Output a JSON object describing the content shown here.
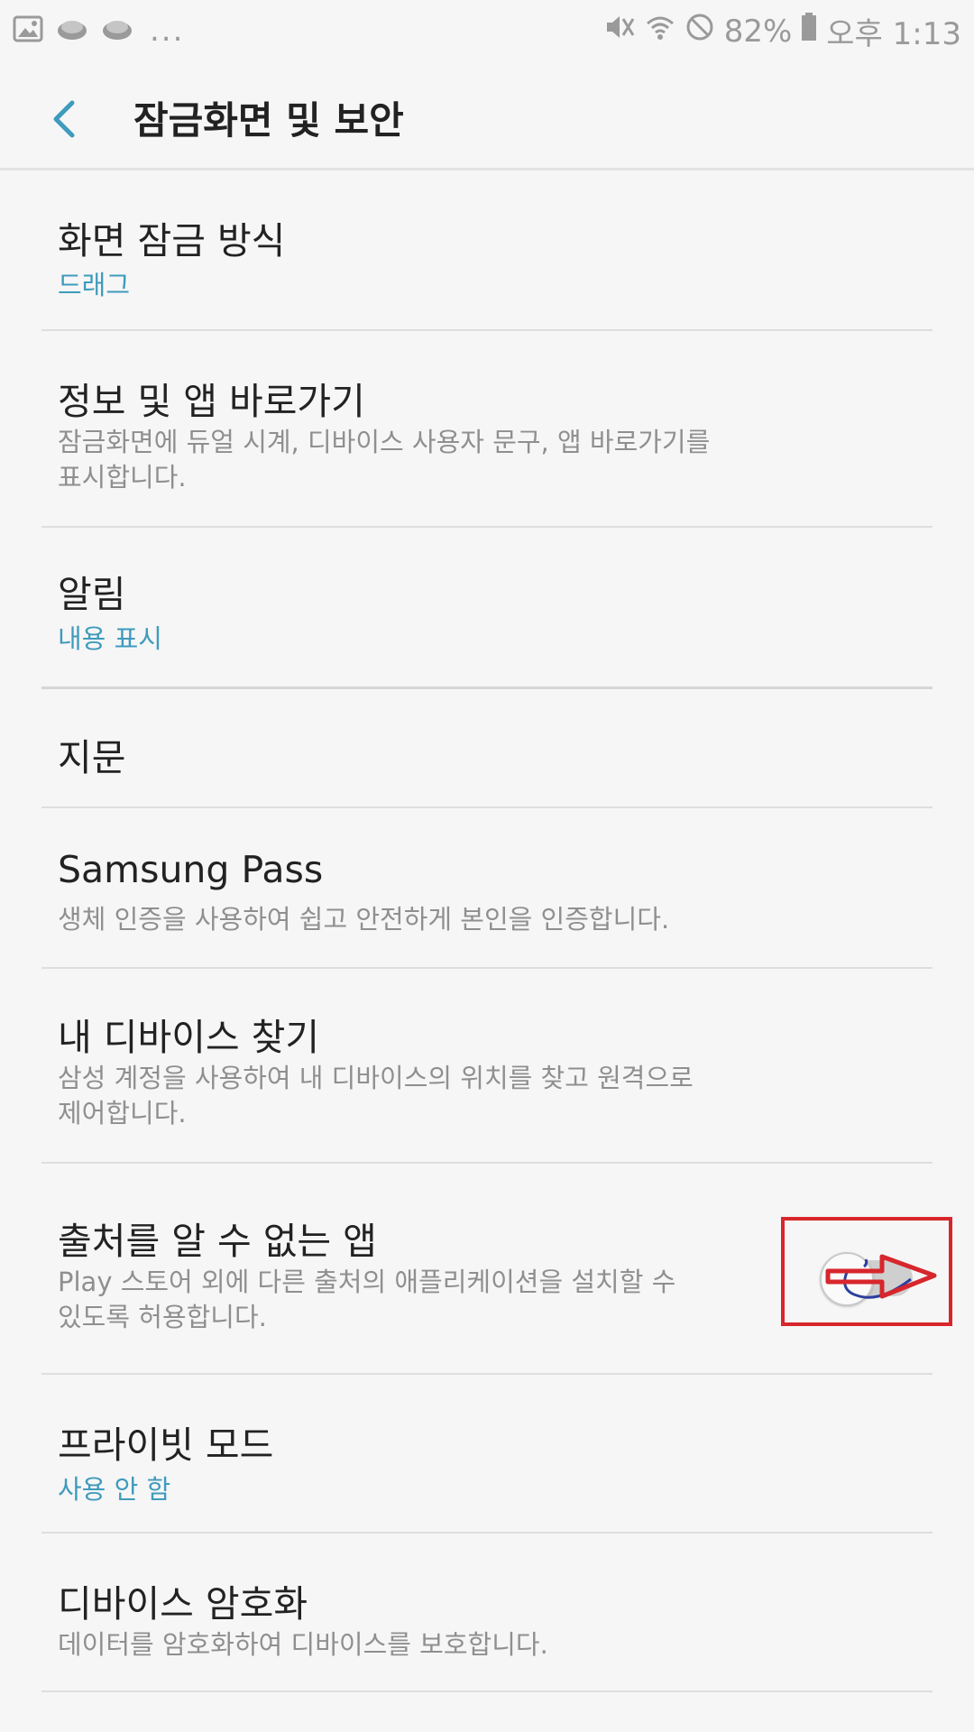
{
  "status_bar": {
    "more": "...",
    "battery": "82%",
    "time": "오후 1:13"
  },
  "header": {
    "title": "잠금화면 및 보안"
  },
  "items": [
    {
      "title": "화면 잠금 방식",
      "subtitle": "드래그",
      "subtitle_style": "accent"
    },
    {
      "title": "정보 및 앱 바로가기",
      "subtitle_lines": [
        "잠금화면에 듀얼 시계, 디바이스 사용자 문구, 앱 바로가기를",
        "표시합니다."
      ]
    },
    {
      "title": "알림",
      "subtitle": "내용 표시",
      "subtitle_style": "accent"
    },
    {
      "title": "지문"
    },
    {
      "title": "Samsung Pass",
      "subtitle_lines": [
        "생체 인증을 사용하여 쉽고 안전하게 본인을 인증합니다."
      ]
    },
    {
      "title": "내 디바이스 찾기",
      "subtitle_lines": [
        "삼성 계정을 사용하여 내 디바이스의 위치를 찾고 원격으로",
        "제어합니다."
      ]
    },
    {
      "title": "출처를 알 수 없는 앱",
      "subtitle_lines": [
        "Play 스토어 외에 다른 출처의 애플리케이션을 설치할 수",
        "있도록 허용합니다."
      ],
      "toggle_on": false
    },
    {
      "title": "프라이빗 모드",
      "subtitle": "사용 안 함",
      "subtitle_style": "accent"
    },
    {
      "title": "디바이스 암호화",
      "subtitle_lines": [
        "데이터를 암호화하여 디바이스를 보호합니다."
      ]
    }
  ],
  "colors": {
    "accent": "#3f9bbd",
    "annotation_red": "#d7262c",
    "annotation_blue": "#2b3f9e"
  }
}
